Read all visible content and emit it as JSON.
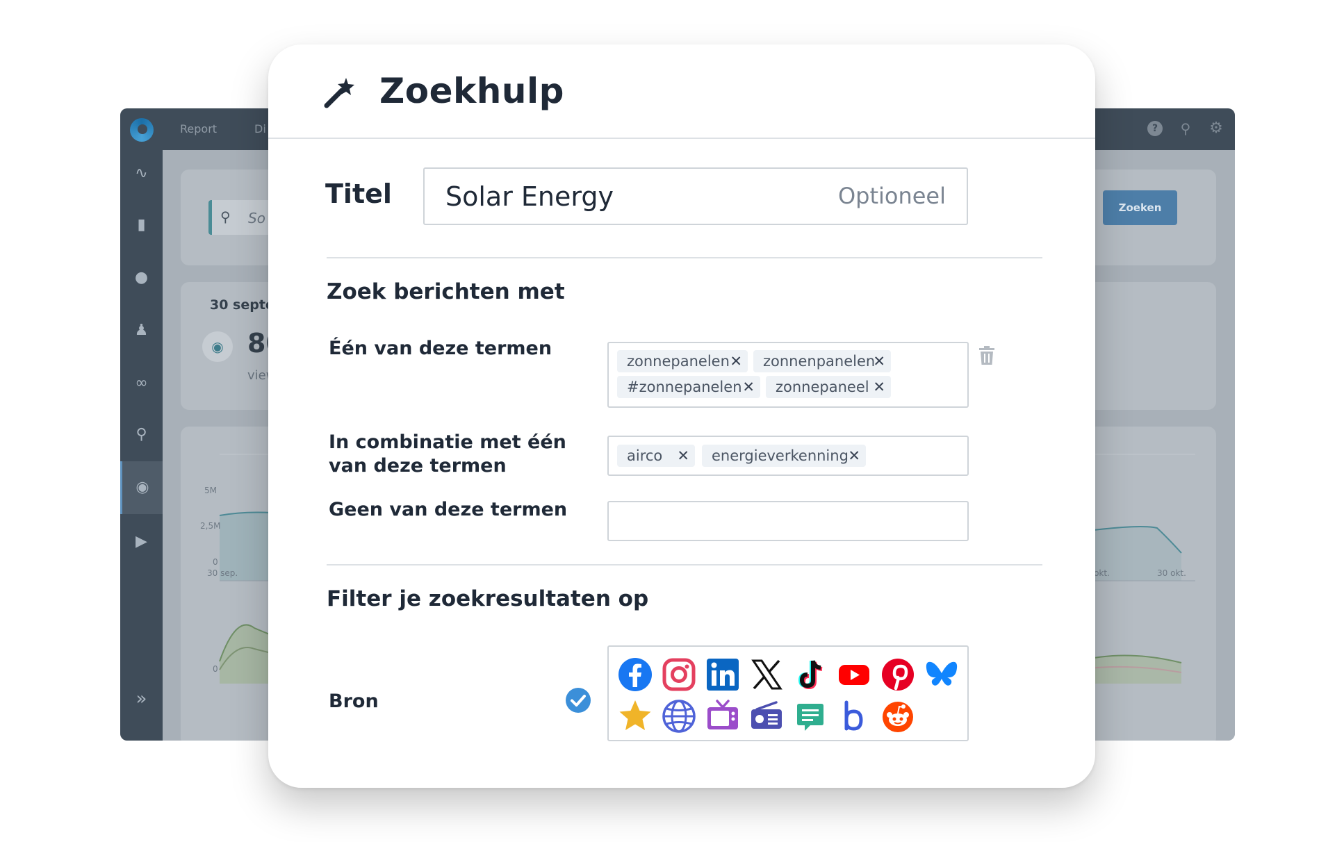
{
  "background": {
    "nav": [
      "Report",
      "Di"
    ],
    "search_placeholder": "So",
    "search_button": "Zoeken",
    "date": "30 septe",
    "big_number": "80",
    "metric_label": "view",
    "y_ticks": [
      "5M",
      "2,5M",
      "0"
    ],
    "x_ticks_left": [
      "30 sep."
    ],
    "x_ticks_right": [
      "28 okt.",
      "30 okt."
    ],
    "second_chart_tick": "0"
  },
  "dialog": {
    "title": "Zoekhulp",
    "titel": {
      "label": "Titel",
      "value": "Solar Energy",
      "placeholder": "Optioneel"
    },
    "section_search": "Zoek berichten met",
    "any_terms": {
      "label": "Één van deze termen",
      "tags": [
        "zonnepanelen",
        "zonnenpanelen",
        "#zonnepanelen",
        "zonnepaneel"
      ]
    },
    "combined_terms": {
      "label": "In combinatie met één van deze termen",
      "tags": [
        "airco",
        "energieverkenning"
      ]
    },
    "none_terms": {
      "label": "Geen van deze termen",
      "tags": []
    },
    "section_filter": "Filter je zoekresultaten op",
    "source": {
      "label": "Bron",
      "checked": true,
      "icons": [
        "facebook-icon",
        "instagram-icon",
        "linkedin-icon",
        "x-icon",
        "tiktok-icon",
        "youtube-icon",
        "pinterest-icon",
        "bluesky-icon",
        "star-icon",
        "web-icon",
        "tv-icon",
        "radio-icon",
        "forum-icon",
        "b-icon",
        "reddit-icon"
      ]
    }
  },
  "colors": {
    "facebook": "#1877f2",
    "instagram": "#e4405f",
    "linkedin": "#0a66c2",
    "youtube": "#ff0000",
    "pinterest": "#e60023",
    "bluesky": "#1185fe",
    "star": "#f0b429",
    "web": "#4f63d8",
    "tv": "#9b4dca",
    "radio": "#4c4fb0",
    "forum": "#2fae8f",
    "reddit": "#ff4500",
    "check": "#3b8fd9",
    "tag_bg": "#eef2f6"
  }
}
